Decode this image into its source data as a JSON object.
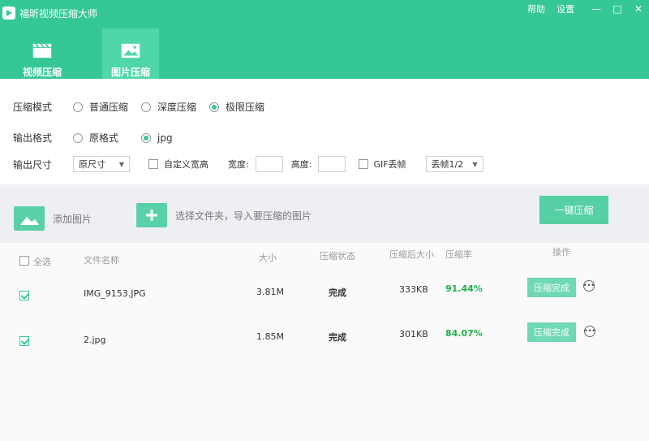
{
  "app": {
    "title": "福昕视频压缩大师",
    "help": "帮助",
    "settings": "设置",
    "minimize": "—",
    "maximize": "□",
    "close": "✕"
  },
  "tabs": [
    {
      "label": "视频压缩",
      "icon": "clapperboard-icon",
      "active": false
    },
    {
      "label": "图片压缩",
      "icon": "image-icon",
      "active": true
    }
  ],
  "compress_mode": {
    "label": "压缩模式",
    "options": [
      "普通压缩",
      "深度压缩",
      "极限压缩"
    ],
    "selected": "极限压缩"
  },
  "output_format": {
    "label": "输出格式",
    "options": [
      "原格式",
      "jpg"
    ],
    "selected": "jpg"
  },
  "output_size": {
    "label": "输出尺寸",
    "select_value": "原尺寸",
    "custom_wh_label": "自定义宽高",
    "width_label": "宽度:",
    "height_label": "高度:",
    "gif_label": "GIF丢帧",
    "gif_select_value": "丢帧1/2"
  },
  "toolbar": {
    "add_image": "添加图片",
    "choose_folder": "选择文件夹，导入要压缩的图片",
    "one_key": "一键压缩"
  },
  "table": {
    "headers": {
      "select_all": "全选",
      "filename": "文件名称",
      "size": "大小",
      "status": "压缩状态",
      "after_size": "压缩后大小",
      "rate": "压缩率",
      "action": "操作"
    },
    "rows": [
      {
        "checked": true,
        "filename": "IMG_9153.JPG",
        "size": "3.81M",
        "status": "完成",
        "after_size": "333KB",
        "rate": "91.44%",
        "action": "压缩完成"
      },
      {
        "checked": true,
        "filename": "2.jpg",
        "size": "1.85M",
        "status": "完成",
        "after_size": "301KB",
        "rate": "84.07%",
        "action": "压缩完成"
      }
    ]
  },
  "colors": {
    "brand": "#35c896",
    "rate": "#22b14c"
  }
}
